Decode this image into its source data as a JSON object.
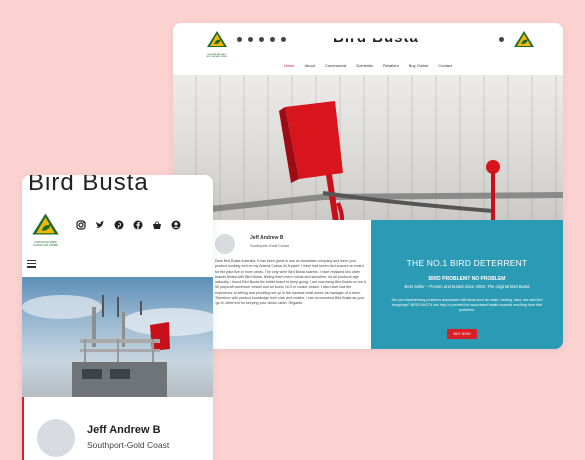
{
  "brand": {
    "logo_text": "AUSTRALIAN MADE AUSTRALIAN OWNED",
    "title": "Bird Busta"
  },
  "desktop": {
    "social_icons": [
      "instagram-icon",
      "twitter-icon",
      "pinterest-icon",
      "facebook-icon",
      "basket-icon"
    ],
    "nav": {
      "home": "Home",
      "about": "About",
      "commercial": "Commercial",
      "domestic": "Domestic",
      "retailers": "Retailers",
      "buy_online": "Buy Online",
      "contact": "Contact"
    },
    "testimonial": {
      "name": "Jeff Andrew B",
      "location": "Southport-Gold Coast",
      "body": "Dear Bird Busta Australia, It has been great to use an Australian company and have your product working well on my Adams Catina 44 ft yacht. I have had seven bird scarers on board for the past five or more years. The only were Bird Busta scarers. I have replaced two other brands tested with Bird Busta, finding them more robust and smoother. As all products age naturally, I found Bird Busta the better brand to keep going. I am now using Bird Busta on our A 50 polycraft commuter vessel and an iconic 16.5 m cruiser vessel. I also have had the experience of selling and providing set up in the nautical retail sector as manager of a store. Therefore with product knowledge from user and retailer, I can recommend Bird Busta as your 'go to' deterrent for keeping your decks clean. Regards."
    },
    "promo": {
      "headline": "THE NO.1 BIRD DETERRENT",
      "subheadline": "BIRD PROBLEM? NO PROBLEM",
      "tagline": "Best Seller – Proven and tested since 2000. The original Bird Busta",
      "body": "Are you experiencing problems associated with birds such as noise, nesting, ticks, lice and bird droppings? BIRD BUSTA can help to prevent the associated health hazards resulting from bird problems.",
      "button": "BUY NOW"
    }
  },
  "mobile": {
    "header_icons": [
      "instagram-icon",
      "twitter-icon",
      "pinterest-icon",
      "facebook-icon",
      "basket-icon",
      "user-icon"
    ],
    "testimonial": {
      "name": "Jeff Andrew B",
      "location": "Southport-Gold Coast"
    }
  },
  "colors": {
    "background": "#fdd3d2",
    "accent_red": "#d81f26",
    "promo_blue": "#2b9ab4",
    "logo_green": "#1f6b2d",
    "logo_gold": "#f2b705"
  }
}
